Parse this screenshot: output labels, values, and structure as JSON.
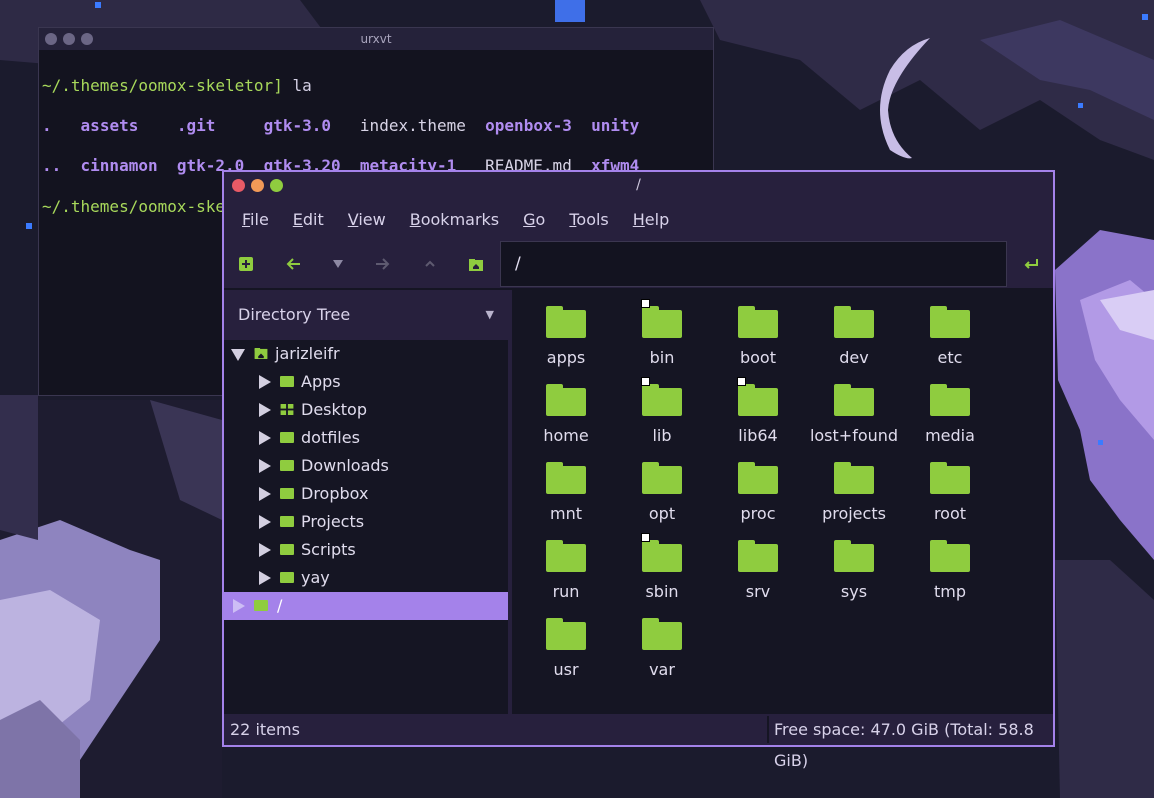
{
  "colors": {
    "accent": "#a482ea",
    "folder": "#8fcc3f",
    "chrome": "#27203d",
    "background": "#151523"
  },
  "terminal": {
    "title": "urxvt",
    "lines": [
      {
        "prompt": "~/.themes/oomox-skeletor]",
        "command": " la"
      },
      {
        "entries": [
          ".",
          "assets",
          ".git",
          "gtk-3.0",
          "index.theme",
          "openbox-3",
          "unity"
        ]
      },
      {
        "entries": [
          "..",
          "cinnamon",
          "gtk-2.0",
          "gtk-3.20",
          "metacity-1",
          "README.md",
          "xfwm4"
        ]
      },
      {
        "prompt": "~/.themes/oomox-skeletor]",
        "command": " "
      }
    ]
  },
  "file_manager": {
    "title": "/",
    "menu": [
      {
        "mnemonic": "F",
        "rest": "ile"
      },
      {
        "mnemonic": "E",
        "rest": "dit"
      },
      {
        "mnemonic": "V",
        "rest": "iew"
      },
      {
        "mnemonic": "B",
        "rest": "ookmarks"
      },
      {
        "mnemonic": "G",
        "rest": "o"
      },
      {
        "mnemonic": "T",
        "rest": "ools"
      },
      {
        "mnemonic": "H",
        "rest": "elp"
      }
    ],
    "toolbar": {
      "new_tab_icon": "plus-square-icon",
      "back_icon": "arrow-left-icon",
      "history_icon": "triangle-down-icon",
      "forward_icon": "arrow-right-icon",
      "up_icon": "chevron-up-icon",
      "home_icon": "home-folder-icon",
      "go_icon": "enter-arrow-icon",
      "location_value": "/"
    },
    "sidebar": {
      "mode_label": "Directory Tree",
      "items": [
        {
          "label": "jarizleifr",
          "expanded": true,
          "icon": "home-folder-icon"
        },
        {
          "label": "Apps",
          "icon": "folder-icon"
        },
        {
          "label": "Desktop",
          "icon": "desktop-folder-icon"
        },
        {
          "label": "dotfiles",
          "icon": "folder-icon"
        },
        {
          "label": "Downloads",
          "icon": "folder-icon"
        },
        {
          "label": "Dropbox",
          "icon": "folder-icon"
        },
        {
          "label": "Projects",
          "icon": "folder-icon"
        },
        {
          "label": "Scripts",
          "icon": "folder-icon"
        },
        {
          "label": "yay",
          "icon": "folder-icon"
        },
        {
          "label": "/",
          "icon": "folder-icon",
          "selected": true
        }
      ]
    },
    "files": [
      {
        "name": "apps"
      },
      {
        "name": "bin",
        "link": true
      },
      {
        "name": "boot"
      },
      {
        "name": "dev"
      },
      {
        "name": "etc"
      },
      {
        "name": "home"
      },
      {
        "name": "lib",
        "link": true
      },
      {
        "name": "lib64",
        "link": true
      },
      {
        "name": "lost+found"
      },
      {
        "name": "media"
      },
      {
        "name": "mnt"
      },
      {
        "name": "opt"
      },
      {
        "name": "proc"
      },
      {
        "name": "projects"
      },
      {
        "name": "root"
      },
      {
        "name": "run"
      },
      {
        "name": "sbin",
        "link": true
      },
      {
        "name": "srv"
      },
      {
        "name": "sys"
      },
      {
        "name": "tmp"
      },
      {
        "name": "usr"
      },
      {
        "name": "var"
      }
    ],
    "status": {
      "items": "22 items",
      "free_space": "Free space: 47.0 GiB (Total: 58.8 GiB)"
    }
  }
}
